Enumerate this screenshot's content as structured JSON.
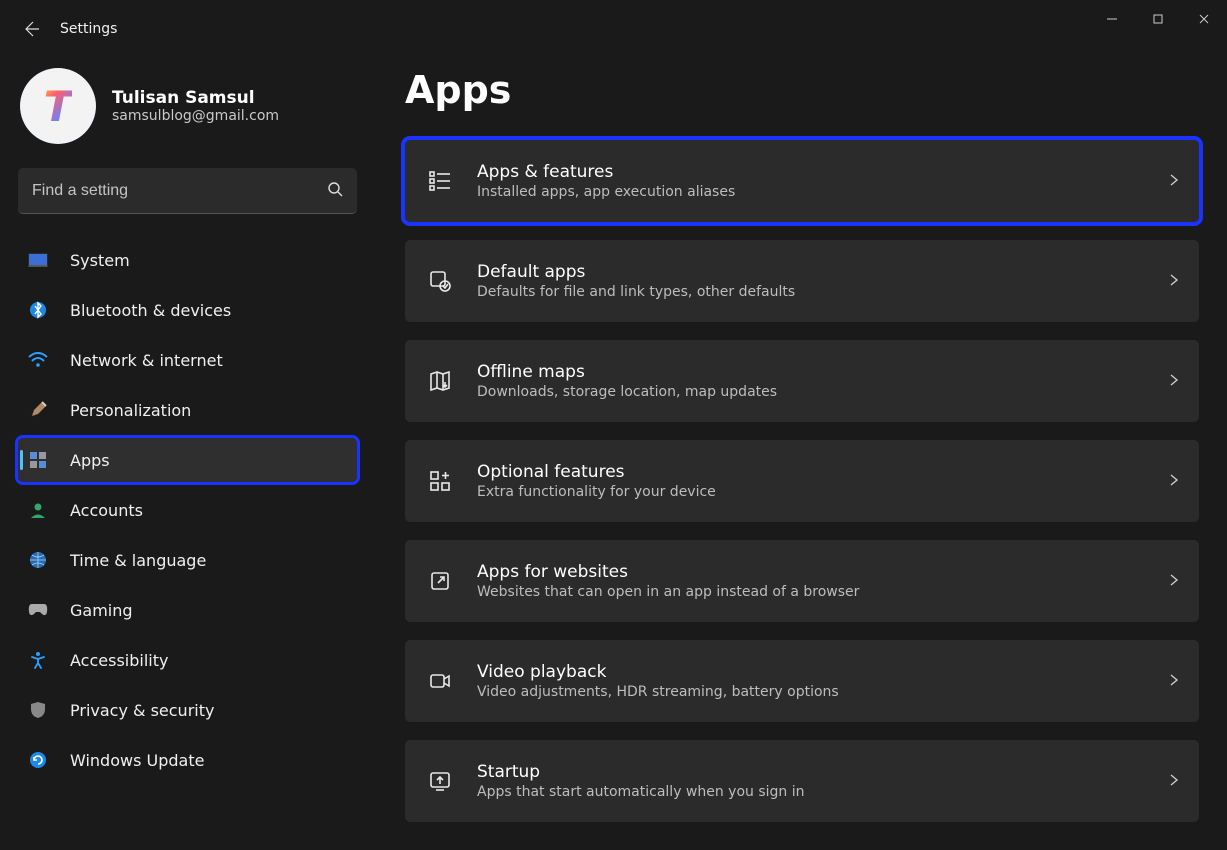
{
  "window": {
    "title": "Settings"
  },
  "user": {
    "name": "Tulisan Samsul",
    "email": "samsulblog@gmail.com",
    "avatar_letter": "T"
  },
  "search": {
    "placeholder": "Find a setting"
  },
  "sidebar": {
    "items": [
      {
        "icon": "🖥️",
        "label": "System"
      },
      {
        "icon": "bt",
        "label": "Bluetooth & devices"
      },
      {
        "icon": "📶",
        "label": "Network & internet"
      },
      {
        "icon": "🖌️",
        "label": "Personalization"
      },
      {
        "icon": "apps",
        "label": "Apps"
      },
      {
        "icon": "👤",
        "label": "Accounts"
      },
      {
        "icon": "🌐",
        "label": "Time & language"
      },
      {
        "icon": "🎮",
        "label": "Gaming"
      },
      {
        "icon": "acc",
        "label": "Accessibility"
      },
      {
        "icon": "🛡️",
        "label": "Privacy & security"
      },
      {
        "icon": "🔄",
        "label": "Windows Update"
      }
    ]
  },
  "main": {
    "title": "Apps",
    "cards": [
      {
        "title": "Apps & features",
        "desc": "Installed apps, app execution aliases"
      },
      {
        "title": "Default apps",
        "desc": "Defaults for file and link types, other defaults"
      },
      {
        "title": "Offline maps",
        "desc": "Downloads, storage location, map updates"
      },
      {
        "title": "Optional features",
        "desc": "Extra functionality for your device"
      },
      {
        "title": "Apps for websites",
        "desc": "Websites that can open in an app instead of a browser"
      },
      {
        "title": "Video playback",
        "desc": "Video adjustments, HDR streaming, battery options"
      },
      {
        "title": "Startup",
        "desc": "Apps that start automatically when you sign in"
      }
    ]
  }
}
